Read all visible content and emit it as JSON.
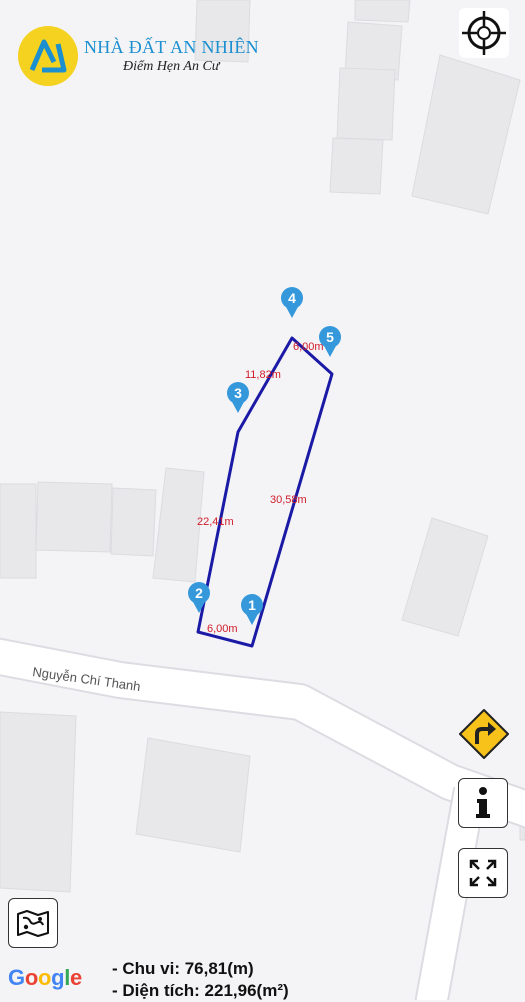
{
  "brand": {
    "name": "NHÀ ĐẤT AN NHIÊN",
    "slogan": "Điểm Hẹn An Cư"
  },
  "map": {
    "street_name": "Nguyễn Chí Thanh",
    "attribution": "Google",
    "attribution_colors": [
      "#4285F4",
      "#EA4335",
      "#FBBC05",
      "#4285F4",
      "#34A853",
      "#EA4335"
    ],
    "parcel_color": "#1a1aa6",
    "label_color": "#d01c2a",
    "pin_color": "#3498db",
    "pins": [
      "1",
      "2",
      "3",
      "4",
      "5"
    ],
    "edges": [
      "6,00m",
      "22,41m",
      "11,82m",
      "6,00m",
      "30,58m"
    ]
  },
  "controls": {
    "gps_icon": "crosshair-icon",
    "directions_icon": "turn-right-sign-icon",
    "info_icon": "info-icon",
    "fullscreen_icon": "expand-icon",
    "layers_icon": "map-layers-icon"
  },
  "stats": {
    "perimeter": "- Chu vi: 76,81(m)",
    "area": "- Diện tích: 221,96(m²)"
  }
}
